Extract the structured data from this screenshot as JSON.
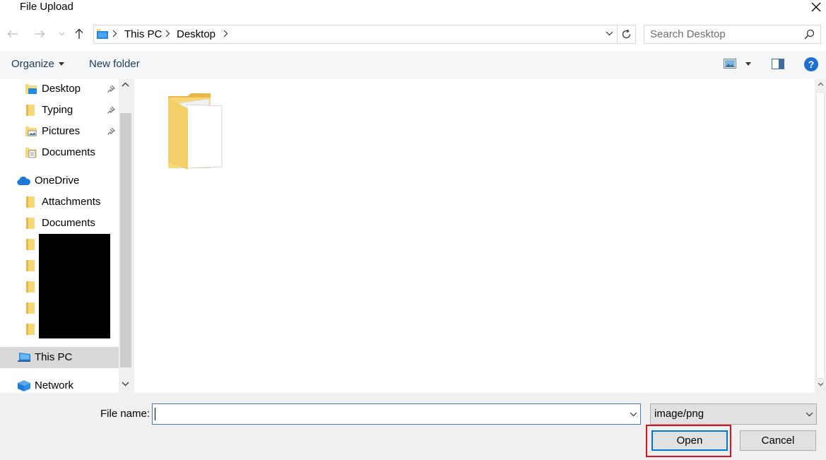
{
  "window": {
    "title": "File Upload"
  },
  "address": {
    "crumbs": [
      "This PC",
      "Desktop"
    ]
  },
  "search": {
    "placeholder": "Search Desktop"
  },
  "toolbar": {
    "organize": "Organize",
    "new_folder": "New folder"
  },
  "nav_pane": {
    "quick_access": [
      {
        "label": "Desktop",
        "pinned": true
      },
      {
        "label": "Typing",
        "pinned": true
      },
      {
        "label": "Pictures",
        "pinned": true
      },
      {
        "label": "Documents",
        "pinned": false
      }
    ],
    "onedrive": "OneDrive",
    "onedrive_items": [
      "Attachments",
      "Documents"
    ],
    "this_pc": "This PC",
    "network": "Network"
  },
  "bottom": {
    "file_name_label": "File name:",
    "file_name_value": "",
    "file_type": "image/png",
    "open": "Open",
    "cancel": "Cancel"
  },
  "colors": {
    "accent": "#0078d7",
    "highlight": "#e0121e",
    "folder": "#f8d775"
  }
}
